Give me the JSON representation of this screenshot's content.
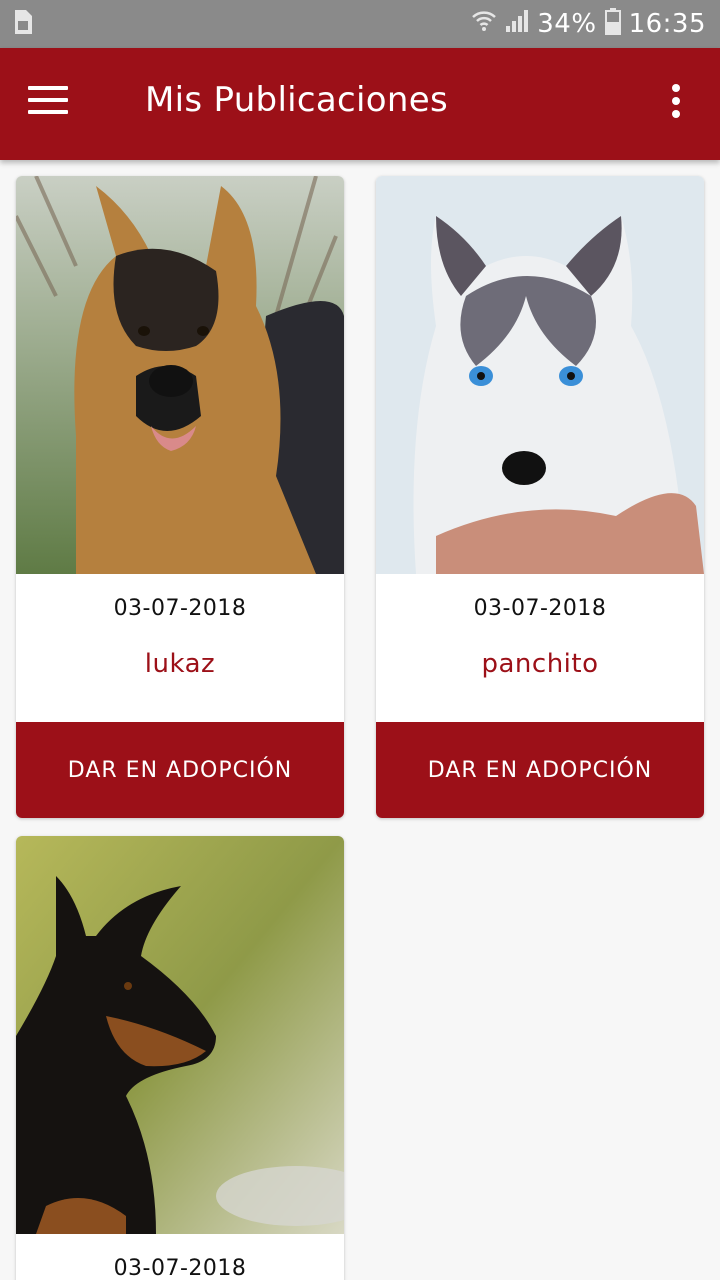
{
  "status_bar": {
    "battery_percent": "34%",
    "time": "16:35",
    "icons": [
      "sim-icon",
      "wifi-icon",
      "signal-icon",
      "battery-icon"
    ]
  },
  "app_bar": {
    "title": "Mis Publicaciones",
    "icons": [
      "menu-icon",
      "more-vert-icon"
    ]
  },
  "colors": {
    "primary": "#9c1018",
    "status_bar": "#8a8a8a",
    "background": "#f7f7f7"
  },
  "publications": [
    {
      "date": "03-07-2018",
      "name": "lukaz",
      "button_label": "DAR EN ADOPCIÓN",
      "photo": "german-shepherd-photo"
    },
    {
      "date": "03-07-2018",
      "name": "panchito",
      "button_label": "DAR EN ADOPCIÓN",
      "photo": "husky-puppy-photo"
    },
    {
      "date": "03-07-2018",
      "photo": "doberman-photo"
    }
  ]
}
